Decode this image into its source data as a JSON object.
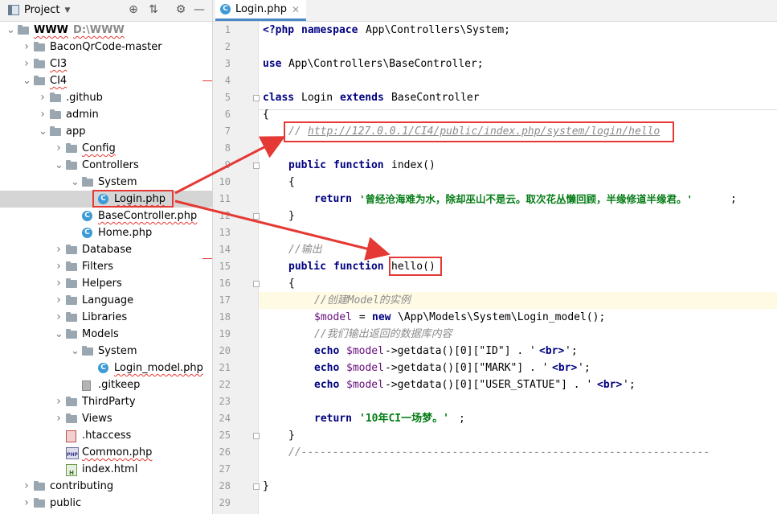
{
  "project_panel": {
    "title": "Project",
    "icons": [
      "crosshair-icon",
      "collapse-icon",
      "gear-icon",
      "minimize-icon"
    ]
  },
  "tree": [
    {
      "name": "WWW",
      "extra": "D:\\WWW",
      "type": "folder",
      "expanded": true,
      "bold": true
    },
    {
      "name": "BaconQrCode-master",
      "type": "folder",
      "expanded": false
    },
    {
      "name": "CI3",
      "type": "folder",
      "expanded": false
    },
    {
      "name": "CI4",
      "type": "folder",
      "expanded": true
    },
    {
      "name": ".github",
      "type": "folder",
      "expanded": false
    },
    {
      "name": "admin",
      "type": "folder",
      "expanded": false
    },
    {
      "name": "app",
      "type": "folder",
      "expanded": true
    },
    {
      "name": "Config",
      "type": "folder",
      "expanded": false
    },
    {
      "name": "Controllers",
      "type": "folder",
      "expanded": true
    },
    {
      "name": "System",
      "type": "folder",
      "expanded": true
    },
    {
      "name": "Login.php",
      "type": "class",
      "selected": true
    },
    {
      "name": "BaseController.php",
      "type": "class"
    },
    {
      "name": "Home.php",
      "type": "class"
    },
    {
      "name": "Database",
      "type": "folder",
      "expanded": false
    },
    {
      "name": "Filters",
      "type": "folder",
      "expanded": false
    },
    {
      "name": "Helpers",
      "type": "folder",
      "expanded": false
    },
    {
      "name": "Language",
      "type": "folder",
      "expanded": false
    },
    {
      "name": "Libraries",
      "type": "folder",
      "expanded": false
    },
    {
      "name": "Models",
      "type": "folder",
      "expanded": true
    },
    {
      "name": "System",
      "type": "folder",
      "expanded": true
    },
    {
      "name": "Login_model.php",
      "type": "class"
    },
    {
      "name": ".gitkeep",
      "type": "file"
    },
    {
      "name": "ThirdParty",
      "type": "folder",
      "expanded": false
    },
    {
      "name": "Views",
      "type": "folder",
      "expanded": false
    },
    {
      "name": ".htaccess",
      "type": "htaccess"
    },
    {
      "name": "Common.php",
      "type": "php"
    },
    {
      "name": "index.html",
      "type": "html"
    },
    {
      "name": "contributing",
      "type": "folder",
      "expanded": false
    },
    {
      "name": "public",
      "type": "folder",
      "expanded": false
    }
  ],
  "editor": {
    "tab_label": "Login.php",
    "line_numbers": [
      "1",
      "2",
      "3",
      "4",
      "5",
      "6",
      "7",
      "8",
      "9",
      "10",
      "11",
      "12",
      "13",
      "14",
      "15",
      "16",
      "17",
      "18",
      "19",
      "20",
      "21",
      "22",
      "23",
      "24",
      "25",
      "26",
      "27",
      "28",
      "29"
    ],
    "lines": {
      "l1_open": "<?php",
      "l1_ns_kw": "namespace",
      "l1_ns": "App\\Controllers\\System;",
      "l3_use": "use",
      "l3_path": "App\\Controllers\\BaseController;",
      "l5_class": "class",
      "l5_name": "Login",
      "l5_extends": "extends",
      "l5_parent": "BaseController",
      "brace_open": "{",
      "brace_close": "}",
      "l7_slashes": "//",
      "l7_url": "http://127.0.0.1/CI4/public/index.php/system/login/hello",
      "l9_public": "public",
      "l9_function": "function",
      "l9_name": "index()",
      "l11_return": "return",
      "l11_str": "'曾经沧海难为水，除却巫山不是云。取次花丛懒回顾，半缘修道半缘君。'",
      "l11_end": ";",
      "l14_comment": "//输出",
      "l15_public": "public",
      "l15_function": "function",
      "l15_name": "hello()",
      "l17_comment": "//创建Model的实例",
      "l18_var": "$model",
      "l18_eq": " = ",
      "l18_new": "new",
      "l18_class": "\\App\\Models\\System\\Login_model();",
      "l19_comment": "//我们输出返回的数据库内容",
      "echo": "echo",
      "model_var": "$model",
      "l20_rest": "->getdata()[0][\"ID\"] . '",
      "l21_rest": "->getdata()[0][\"MARK\"] . '",
      "l22_rest": "->getdata()[0][\"USER_STATUE\"] . '",
      "br_tag": "<br>",
      "quote_end": "';",
      "l25_return": "return",
      "l25_str": "'10年CI一场梦。'",
      "l25_end": ";",
      "l27_comment": "//-----------------------------------------------------------------"
    }
  },
  "annotation_color": "#e53935"
}
